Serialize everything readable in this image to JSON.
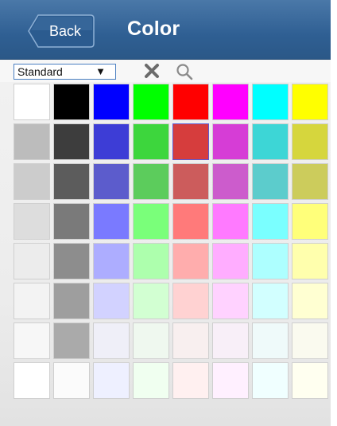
{
  "header": {
    "back_label": "Back",
    "title": "Color"
  },
  "toolbar": {
    "select_value": "Standard",
    "select_arrow": "▼",
    "clear_icon": "x-icon",
    "search_icon": "search-icon"
  },
  "colors": {
    "rows": [
      [
        "#ffffff",
        "#000000",
        "#0000ff",
        "#00ff00",
        "#ff0000",
        "#ff00ff",
        "#00ffff",
        "#ffff00"
      ],
      [
        "#bcbcbc",
        "#3d3d3d",
        "#3d3dd6",
        "#3dd63d",
        "#d63d3d",
        "#d63dd6",
        "#3dd6d6",
        "#d6d63d"
      ],
      [
        "#cccccc",
        "#5c5c5c",
        "#5c5ccc",
        "#5ccc5c",
        "#cc5c5c",
        "#cc5ccc",
        "#5ccccc",
        "#cccc5c"
      ],
      [
        "#dddddd",
        "#7a7a7a",
        "#7a7aff",
        "#7aff7a",
        "#ff7a7a",
        "#ff7aff",
        "#7affff",
        "#ffff7a"
      ],
      [
        "#ececec",
        "#8d8d8d",
        "#adadff",
        "#adffad",
        "#ffadad",
        "#ffadff",
        "#adffff",
        "#ffffad"
      ],
      [
        "#f3f3f3",
        "#9e9e9e",
        "#d2d2ff",
        "#d2ffd2",
        "#ffd2d2",
        "#ffd2ff",
        "#d2ffff",
        "#ffffd2"
      ],
      [
        "#f7f7f7",
        "#aaaaaa",
        "#efeff8",
        "#eff8ef",
        "#f8efef",
        "#f8eff8",
        "#effafa",
        "#fafaef"
      ],
      [
        "#ffffff",
        "#fbfbfb",
        "#eef0ff",
        "#f0fff0",
        "#fff0f0",
        "#fff0ff",
        "#f0ffff",
        "#fffff0"
      ]
    ],
    "selected": {
      "row": 1,
      "col": 4
    }
  },
  "theme": {
    "header_bg": "#2f5f93",
    "select_border": "#4a7fc1",
    "selection_border": "#5b5bd6"
  }
}
